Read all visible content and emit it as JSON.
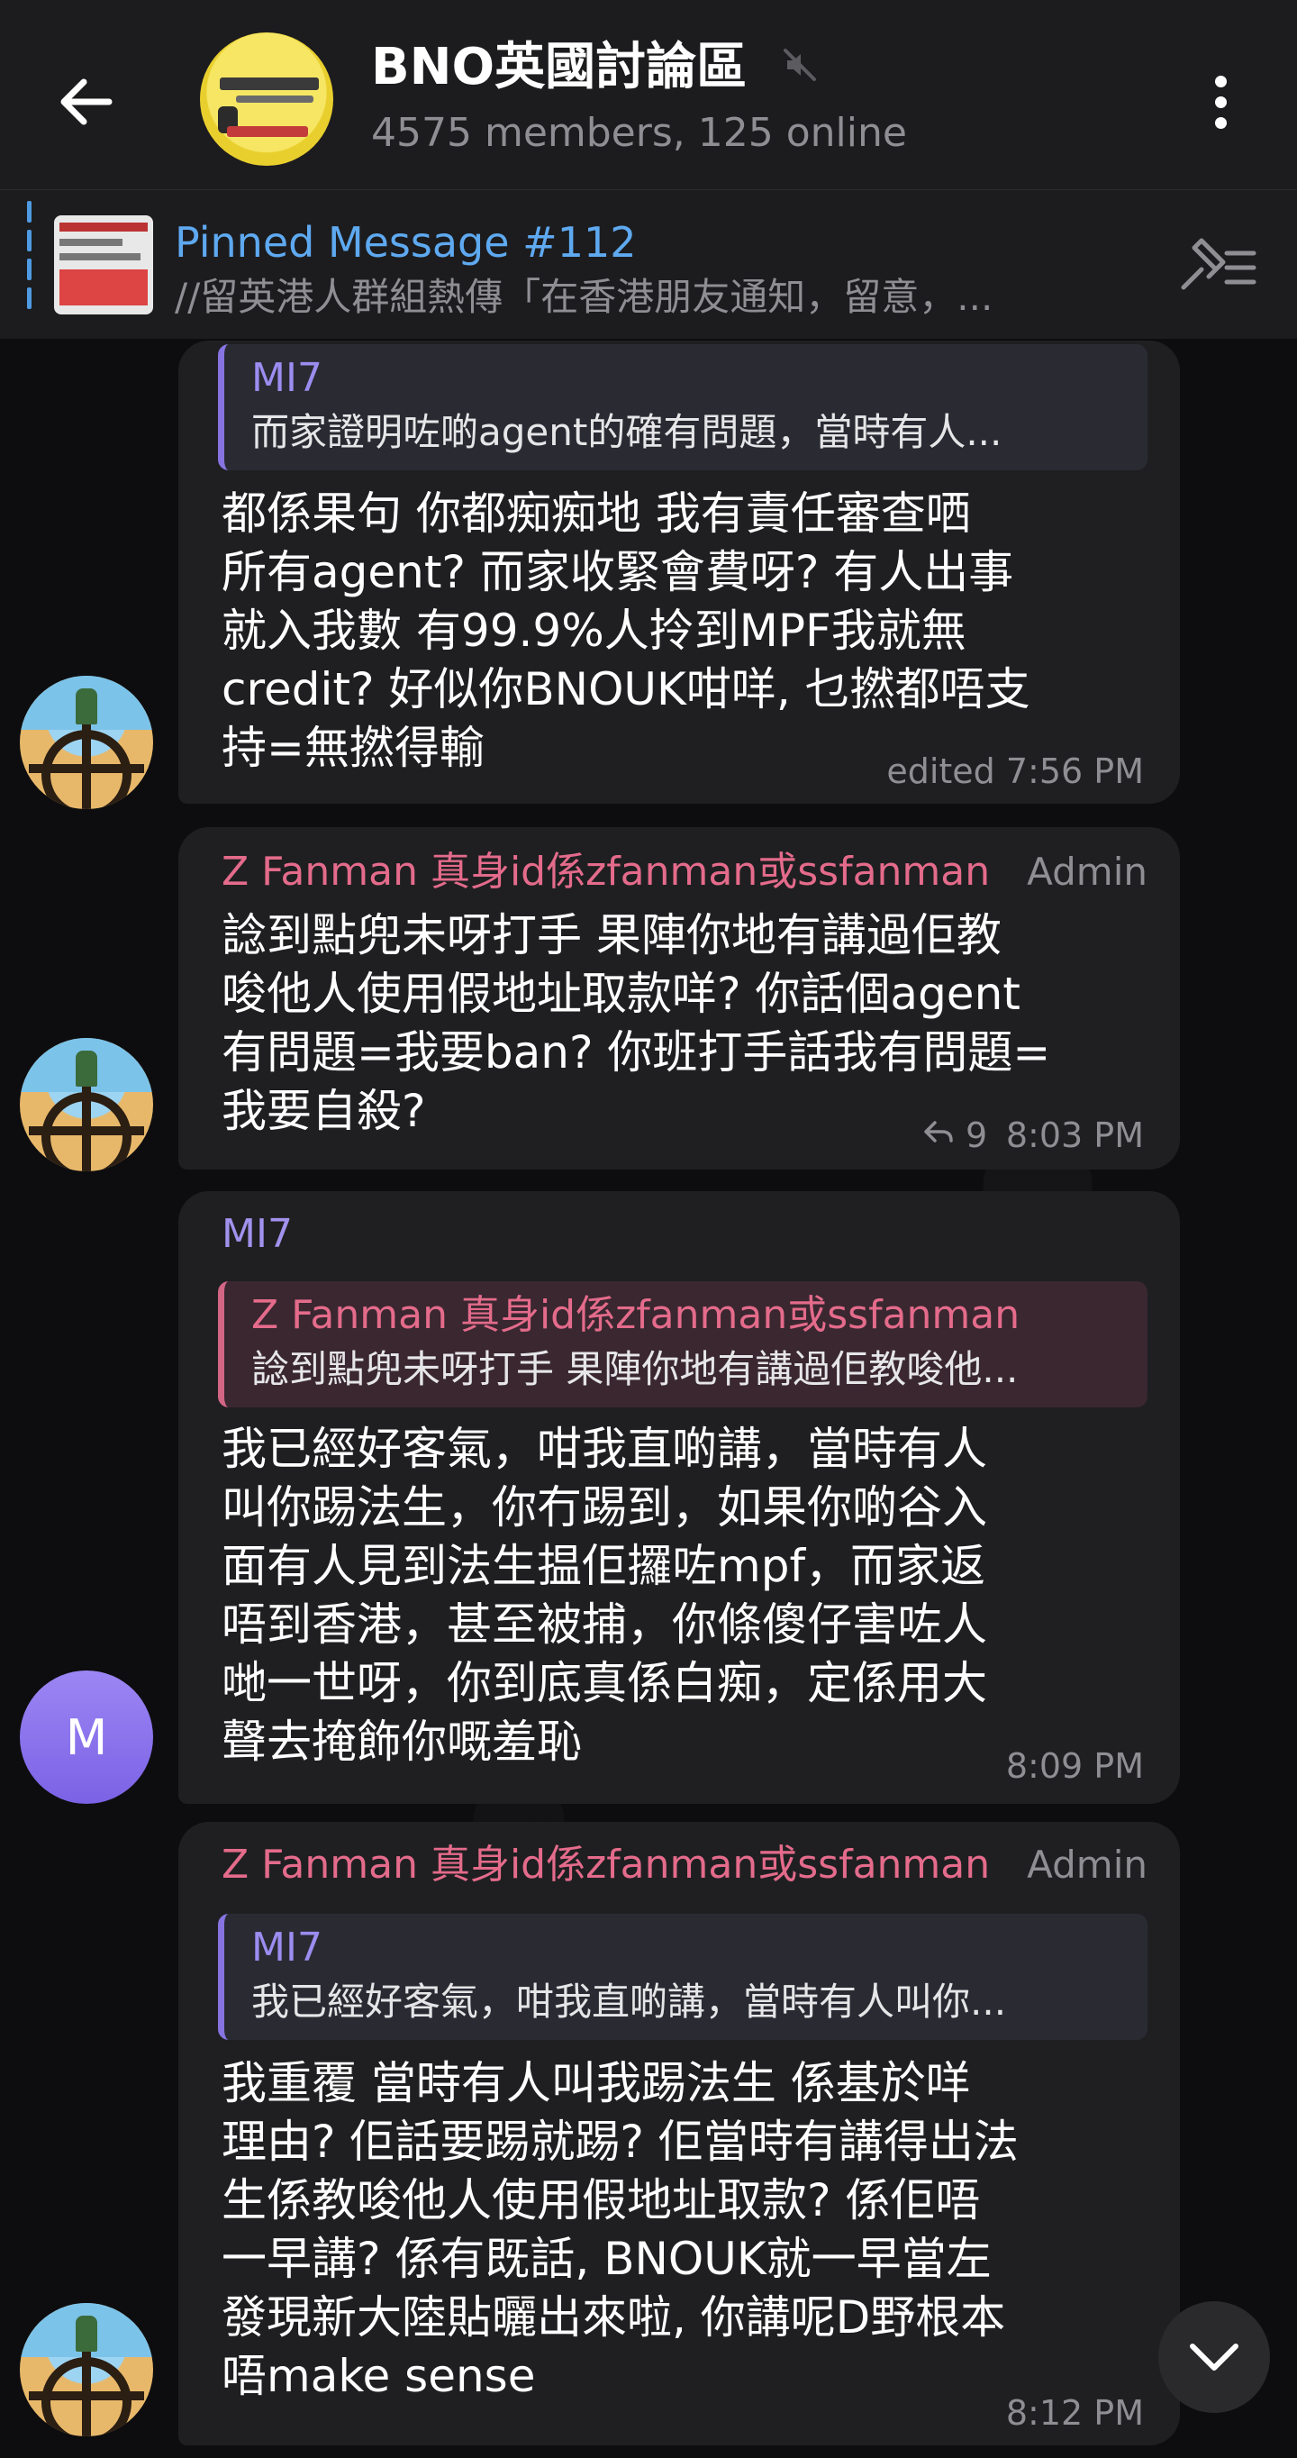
{
  "header": {
    "title": "BNO英國討論區",
    "subtitle": "4575 members, 125 online",
    "icons": {
      "back": "arrow-left-icon",
      "mute": "muted-speaker-icon",
      "menu": "kebab-menu-icon"
    }
  },
  "pinned": {
    "title": "Pinned Message #112",
    "text": "//留英港人群組熱傳「在香港朋友通知，留意，...",
    "icon": "pinned-list-icon"
  },
  "messages": [
    {
      "reply_to": {
        "name": "MI7",
        "text": "而家證明咗啲agent的確有問題，當時有人..."
      },
      "text": "都係果句 你都痴痴地 我有責任審查哂\n所有agent? 而家收緊會費呀? 有人出事\n就入我數 有99.9%人拎到MPF我就無\ncredit? 好似你BNOUK咁咩, 乜撚都唔支\n持=無撚得輸",
      "time": "edited 7:56 PM"
    },
    {
      "sender": "Z Fanman 真身id係zfanman或ssfanman",
      "role": "Admin",
      "text": "諗到點兜未呀打手 果陣你地有講過佢教\n唆他人使用假地址取款咩? 你話個agent\n有問題=我要ban? 你班打手話我有問題=\n我要自殺?",
      "replies": "9",
      "time": "8:03 PM"
    },
    {
      "sender": "MI7",
      "avatar_letter": "M",
      "reply_to": {
        "name": "Z Fanman 真身id係zfanman或ssfanman",
        "text": "諗到點兜未呀打手 果陣你地有講過佢教唆他..."
      },
      "text": "我已經好客氣，咁我直啲講，當時有人\n叫你踢法生，你冇踢到，如果你啲谷入\n面有人見到法生揾佢攞咗mpf，而家返\n唔到香港，甚至被捕，你條傻仔害咗人\n哋一世呀，你到底真係白痴，定係用大\n聲去掩飾你嘅羞恥",
      "time": "8:09 PM"
    },
    {
      "sender": "Z Fanman 真身id係zfanman或ssfanman",
      "role": "Admin",
      "reply_to": {
        "name": "MI7",
        "text": "我已經好客氣，咁我直啲講，當時有人叫你..."
      },
      "text": "我重覆 當時有人叫我踢法生 係基於咩\n理由? 佢話要踢就踢? 佢當時有講得出法\n生係教唆他人使用假地址取款? 係佢唔\n一早講? 係有既話, BNOUK就一早當左\n發現新大陸貼曬出來啦, 你講呢D野根本\n唔make sense",
      "time": "8:12 PM"
    }
  ],
  "colors": {
    "header_bg": "#1c1c1e",
    "bubble_bg": "#1f1f21",
    "admin_name": "#e46b8b",
    "mi7_name": "#a292ee",
    "pinned_title": "#5ea9f0",
    "muted_text": "#8e8e93"
  }
}
